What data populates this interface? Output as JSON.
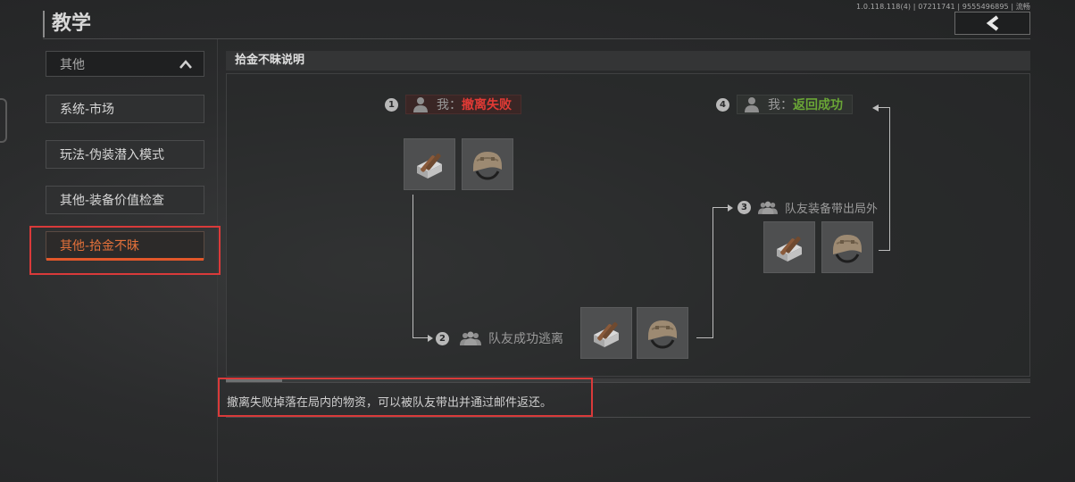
{
  "version_text": "1.0.118.118(4) | 07211741 | 9555496895 | 流畅",
  "header": {
    "title": "教学"
  },
  "sidebar": {
    "category_label": "其他",
    "items": [
      {
        "label": "系统-市场"
      },
      {
        "label": "玩法-伪装潜入模式"
      },
      {
        "label": "其他-装备价值检查"
      },
      {
        "label": "其他-拾金不昧"
      }
    ],
    "active_index": 3
  },
  "section": {
    "title": "拾金不昧说明"
  },
  "diagram": {
    "step1": {
      "number": "1",
      "prefix": "我：",
      "status": "撤离失败"
    },
    "step2": {
      "number": "2",
      "label": "队友成功逃离"
    },
    "step3": {
      "number": "3",
      "label": "队友装备带出局外"
    },
    "step4": {
      "number": "4",
      "prefix": "我：",
      "status": "返回成功"
    }
  },
  "progress": {
    "fraction": 0.07
  },
  "description": "撤离失败掉落在局内的物资，可以被队友带出并通过邮件返还。",
  "colors": {
    "accent": "#e2572a",
    "fail": "#e13a35",
    "success": "#6aa636",
    "highlight_box": "#d93a3a"
  },
  "icons": [
    "back-arrow-icon",
    "chevron-up-icon",
    "person-icon",
    "team-icon",
    "ammo-box-icon",
    "helmet-icon"
  ]
}
